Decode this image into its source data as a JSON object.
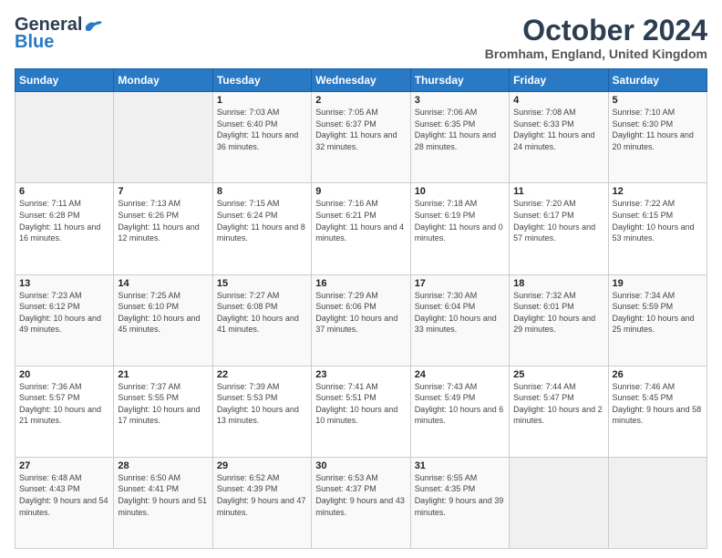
{
  "header": {
    "logo_general": "General",
    "logo_blue": "Blue",
    "month_title": "October 2024",
    "location": "Bromham, England, United Kingdom"
  },
  "days_of_week": [
    "Sunday",
    "Monday",
    "Tuesday",
    "Wednesday",
    "Thursday",
    "Friday",
    "Saturday"
  ],
  "weeks": [
    [
      {
        "day": "",
        "info": ""
      },
      {
        "day": "",
        "info": ""
      },
      {
        "day": "1",
        "info": "Sunrise: 7:03 AM\nSunset: 6:40 PM\nDaylight: 11 hours\nand 36 minutes."
      },
      {
        "day": "2",
        "info": "Sunrise: 7:05 AM\nSunset: 6:37 PM\nDaylight: 11 hours\nand 32 minutes."
      },
      {
        "day": "3",
        "info": "Sunrise: 7:06 AM\nSunset: 6:35 PM\nDaylight: 11 hours\nand 28 minutes."
      },
      {
        "day": "4",
        "info": "Sunrise: 7:08 AM\nSunset: 6:33 PM\nDaylight: 11 hours\nand 24 minutes."
      },
      {
        "day": "5",
        "info": "Sunrise: 7:10 AM\nSunset: 6:30 PM\nDaylight: 11 hours\nand 20 minutes."
      }
    ],
    [
      {
        "day": "6",
        "info": "Sunrise: 7:11 AM\nSunset: 6:28 PM\nDaylight: 11 hours\nand 16 minutes."
      },
      {
        "day": "7",
        "info": "Sunrise: 7:13 AM\nSunset: 6:26 PM\nDaylight: 11 hours\nand 12 minutes."
      },
      {
        "day": "8",
        "info": "Sunrise: 7:15 AM\nSunset: 6:24 PM\nDaylight: 11 hours\nand 8 minutes."
      },
      {
        "day": "9",
        "info": "Sunrise: 7:16 AM\nSunset: 6:21 PM\nDaylight: 11 hours\nand 4 minutes."
      },
      {
        "day": "10",
        "info": "Sunrise: 7:18 AM\nSunset: 6:19 PM\nDaylight: 11 hours\nand 0 minutes."
      },
      {
        "day": "11",
        "info": "Sunrise: 7:20 AM\nSunset: 6:17 PM\nDaylight: 10 hours\nand 57 minutes."
      },
      {
        "day": "12",
        "info": "Sunrise: 7:22 AM\nSunset: 6:15 PM\nDaylight: 10 hours\nand 53 minutes."
      }
    ],
    [
      {
        "day": "13",
        "info": "Sunrise: 7:23 AM\nSunset: 6:12 PM\nDaylight: 10 hours\nand 49 minutes."
      },
      {
        "day": "14",
        "info": "Sunrise: 7:25 AM\nSunset: 6:10 PM\nDaylight: 10 hours\nand 45 minutes."
      },
      {
        "day": "15",
        "info": "Sunrise: 7:27 AM\nSunset: 6:08 PM\nDaylight: 10 hours\nand 41 minutes."
      },
      {
        "day": "16",
        "info": "Sunrise: 7:29 AM\nSunset: 6:06 PM\nDaylight: 10 hours\nand 37 minutes."
      },
      {
        "day": "17",
        "info": "Sunrise: 7:30 AM\nSunset: 6:04 PM\nDaylight: 10 hours\nand 33 minutes."
      },
      {
        "day": "18",
        "info": "Sunrise: 7:32 AM\nSunset: 6:01 PM\nDaylight: 10 hours\nand 29 minutes."
      },
      {
        "day": "19",
        "info": "Sunrise: 7:34 AM\nSunset: 5:59 PM\nDaylight: 10 hours\nand 25 minutes."
      }
    ],
    [
      {
        "day": "20",
        "info": "Sunrise: 7:36 AM\nSunset: 5:57 PM\nDaylight: 10 hours\nand 21 minutes."
      },
      {
        "day": "21",
        "info": "Sunrise: 7:37 AM\nSunset: 5:55 PM\nDaylight: 10 hours\nand 17 minutes."
      },
      {
        "day": "22",
        "info": "Sunrise: 7:39 AM\nSunset: 5:53 PM\nDaylight: 10 hours\nand 13 minutes."
      },
      {
        "day": "23",
        "info": "Sunrise: 7:41 AM\nSunset: 5:51 PM\nDaylight: 10 hours\nand 10 minutes."
      },
      {
        "day": "24",
        "info": "Sunrise: 7:43 AM\nSunset: 5:49 PM\nDaylight: 10 hours\nand 6 minutes."
      },
      {
        "day": "25",
        "info": "Sunrise: 7:44 AM\nSunset: 5:47 PM\nDaylight: 10 hours\nand 2 minutes."
      },
      {
        "day": "26",
        "info": "Sunrise: 7:46 AM\nSunset: 5:45 PM\nDaylight: 9 hours\nand 58 minutes."
      }
    ],
    [
      {
        "day": "27",
        "info": "Sunrise: 6:48 AM\nSunset: 4:43 PM\nDaylight: 9 hours\nand 54 minutes."
      },
      {
        "day": "28",
        "info": "Sunrise: 6:50 AM\nSunset: 4:41 PM\nDaylight: 9 hours\nand 51 minutes."
      },
      {
        "day": "29",
        "info": "Sunrise: 6:52 AM\nSunset: 4:39 PM\nDaylight: 9 hours\nand 47 minutes."
      },
      {
        "day": "30",
        "info": "Sunrise: 6:53 AM\nSunset: 4:37 PM\nDaylight: 9 hours\nand 43 minutes."
      },
      {
        "day": "31",
        "info": "Sunrise: 6:55 AM\nSunset: 4:35 PM\nDaylight: 9 hours\nand 39 minutes."
      },
      {
        "day": "",
        "info": ""
      },
      {
        "day": "",
        "info": ""
      }
    ]
  ]
}
